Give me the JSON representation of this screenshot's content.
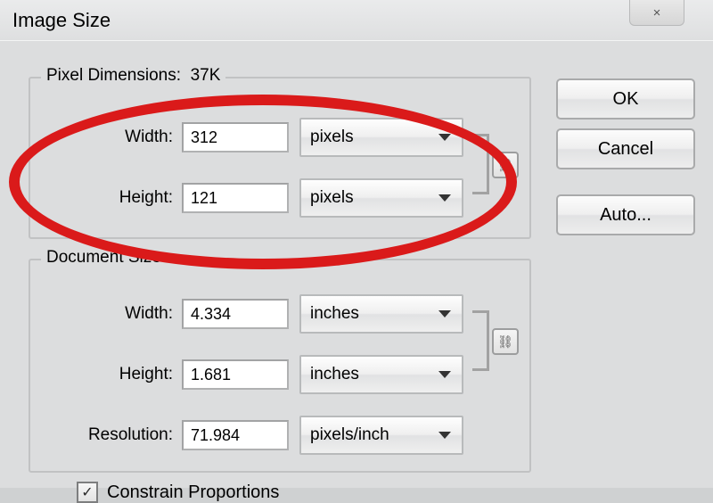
{
  "window": {
    "title": "Image Size",
    "close_symbol": "×"
  },
  "pixel_dimensions": {
    "legend_prefix": "Pixel Dimensions:",
    "size": "37K",
    "width_label": "Width:",
    "width_value": "312",
    "width_unit": "pixels",
    "height_label": "Height:",
    "height_value": "121",
    "height_unit": "pixels"
  },
  "document_size": {
    "legend": "Document Size:",
    "width_label": "Width:",
    "width_value": "4.334",
    "width_unit": "inches",
    "height_label": "Height:",
    "height_value": "1.681",
    "height_unit": "inches",
    "resolution_label": "Resolution:",
    "resolution_value": "71.984",
    "resolution_unit": "pixels/inch"
  },
  "buttons": {
    "ok": "OK",
    "cancel": "Cancel",
    "auto": "Auto..."
  },
  "options": {
    "constrain_label": "Constrain Proportions",
    "constrain_checked": "✓"
  },
  "link_icon_glyph": "⛓"
}
